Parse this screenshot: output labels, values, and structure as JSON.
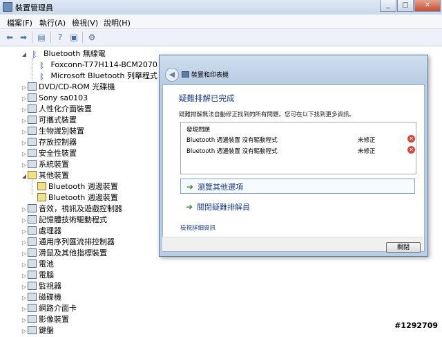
{
  "window": {
    "title": "裝置管理員"
  },
  "menu": [
    "檔案(F)",
    "執行(A)",
    "檢視(V)",
    "說明(H)"
  ],
  "toolbar": {
    "icons": [
      "back-arrow-icon",
      "forward-arrow-icon",
      "properties-icon",
      "help-icon",
      "view-icon",
      "scan-icon"
    ]
  },
  "tree": {
    "bluetooth": {
      "label": "Bluetooth 無線電",
      "children": [
        "Foxconn-T77H114-BCM2070",
        "Microsoft Bluetooth 列舉程式"
      ]
    },
    "categories": [
      "DVD/CD-ROM 光碟機",
      "Sony sa0103",
      "人性化介面裝置",
      "可攜式裝置",
      "生物識別裝置",
      "存放控制器",
      "安全性裝置",
      "系統裝置",
      "其他裝置"
    ],
    "other_children": [
      "Bluetooth 週邊裝置",
      "Bluetooth 週邊裝置"
    ],
    "more_categories": [
      "音效，視訊及遊戲控制器",
      "記憶體技術驅動程式",
      "處理器",
      "通用序列匯流排控制器",
      "滑鼠及其他指標裝置",
      "電池",
      "電腦",
      "監視器",
      "磁碟機",
      "網路介面卡",
      "影像裝置",
      "鍵盤"
    ]
  },
  "dialog": {
    "breadcrumb": "裝置和印表機",
    "heading": "疑難排解已完成",
    "subtitle": "疑難排解無法自動修正找到的所有問題。您可在以下找到更多資訊。",
    "found_title": "發現問題",
    "problems": [
      {
        "text": "Bluetooth 週邊裝置 沒有驅動程式",
        "status": "未修正"
      },
      {
        "text": "Bluetooth 週邊裝置 沒有驅動程式",
        "status": "未修正"
      }
    ],
    "options": [
      "瀏覽其他選項",
      "關閉疑難排解員"
    ],
    "detail_link": "檢視詳細資訊",
    "close_button": "關閉"
  },
  "watermark": "#1292709"
}
